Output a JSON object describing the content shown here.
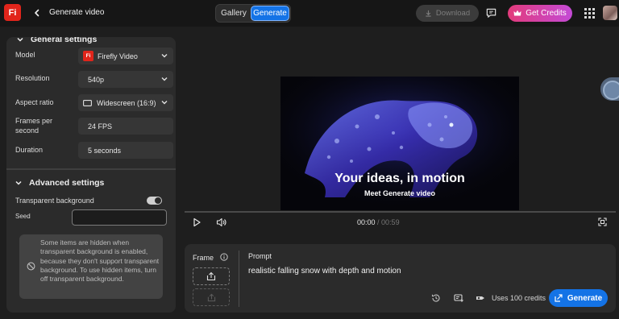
{
  "app": {
    "logo_text": "Fi",
    "title": "Generate video"
  },
  "header": {
    "tabs": [
      {
        "label": "Gallery",
        "active": false
      },
      {
        "label": "Generate",
        "active": true
      }
    ],
    "download_label": "Download",
    "get_credits_label": "Get Credits",
    "accent": "#1473e6"
  },
  "general_settings": {
    "heading": "General settings",
    "model": {
      "label": "Model",
      "value": "Firefly Video",
      "badge": "Fi"
    },
    "resolution": {
      "label": "Resolution",
      "value": "540p"
    },
    "aspect_ratio": {
      "label": "Aspect ratio",
      "value": "Widescreen (16:9)"
    },
    "fps": {
      "label_line1": "Frames per",
      "label_line2": "second",
      "value": "24 FPS"
    },
    "duration": {
      "label": "Duration",
      "value": "5 seconds"
    }
  },
  "advanced_settings": {
    "heading": "Advanced settings",
    "transparent_background": {
      "label": "Transparent background",
      "enabled": true
    },
    "seed": {
      "label": "Seed",
      "value": ""
    },
    "notice": "Some items are hidden when transparent background is enabled, because they don't support transparent background. To use hidden items, turn off transparent background."
  },
  "video": {
    "headline": "Your ideas, in motion",
    "subline": "Meet Generate video",
    "current_time": "00:00",
    "separator": " / ",
    "total_time": "00:59",
    "progress": 0
  },
  "prompt_panel": {
    "frame_label": "Frame",
    "prompt_label": "Prompt",
    "prompt_text": "realistic falling snow with depth and motion",
    "uses_credits": "Uses 100 credits",
    "generate_label": "Generate"
  }
}
